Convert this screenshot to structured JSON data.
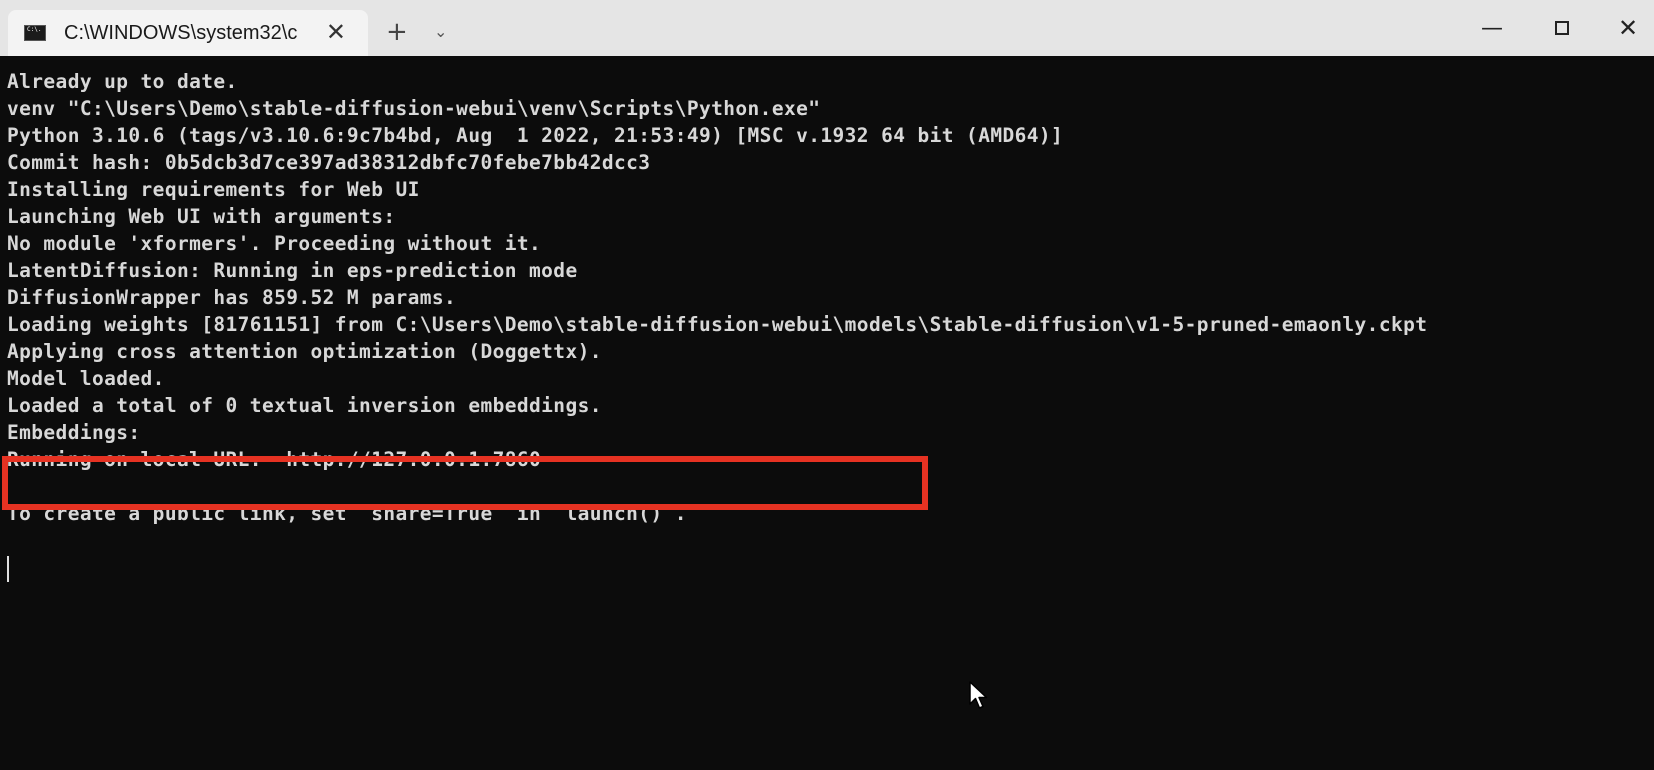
{
  "window": {
    "tab_title": "C:\\WINDOWS\\system32\\c",
    "tab_icon_label": "C:\\.",
    "close_tab_glyph": "✕",
    "new_tab_glyph": "+",
    "dropdown_glyph": "⌄",
    "minimize_glyph": "—",
    "close_glyph": "✕"
  },
  "console": {
    "lines": [
      "Already up to date.",
      "venv \"C:\\Users\\Demo\\stable-diffusion-webui\\venv\\Scripts\\Python.exe\"",
      "Python 3.10.6 (tags/v3.10.6:9c7b4bd, Aug  1 2022, 21:53:49) [MSC v.1932 64 bit (AMD64)]",
      "Commit hash: 0b5dcb3d7ce397ad38312dbfc70febe7bb42dcc3",
      "Installing requirements for Web UI",
      "Launching Web UI with arguments:",
      "No module 'xformers'. Proceeding without it.",
      "LatentDiffusion: Running in eps-prediction mode",
      "DiffusionWrapper has 859.52 M params.",
      "Loading weights [81761151] from C:\\Users\\Demo\\stable-diffusion-webui\\models\\Stable-diffusion\\v1-5-pruned-emaonly.ckpt",
      "Applying cross attention optimization (Doggettx).",
      "Model loaded.",
      "Loaded a total of 0 textual inversion embeddings.",
      "Embeddings:",
      "Running on local URL:  http://127.0.0.1:7860",
      "",
      "To create a public link, set `share=True` in `launch()`."
    ]
  },
  "colors": {
    "console_background": "#0c0c0c",
    "console_text": "#d8d8d8",
    "highlight_border": "#e63222",
    "titlebar": "#e5e5e5",
    "active_tab": "#f3f3f3"
  }
}
